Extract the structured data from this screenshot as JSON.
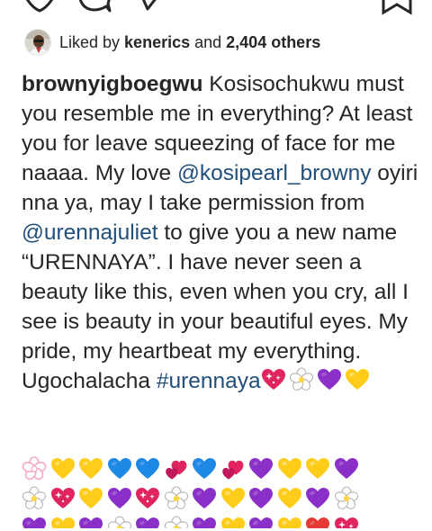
{
  "actions": {
    "like_icon": "heart-outline-icon",
    "comment_icon": "comment-bubble-icon",
    "share_icon": "paper-plane-icon",
    "save_icon": "bookmark-outline-icon"
  },
  "likes": {
    "prefix": "Liked by ",
    "user": "kenerics",
    "middle": " and ",
    "count": "2,404 others"
  },
  "caption": {
    "username": "brownyigboegwu",
    "text_1": " Kosisochukwu must you resemble me in everything? At least you for leave squeezing of face for me naaaa. My love ",
    "mention_1": "@kosipearl_browny",
    "text_2": " oyiri nna ya, may I take permission from ",
    "mention_2": "@urennajuliet",
    "text_3": " to give you a new name “URENNAYA”. I have never seen a beauty like this, even when you cry, all I see is beauty in your beautiful eyes. My pride, my heartbeat my everything. Ugochalacha ",
    "hashtag": "#urennaya"
  },
  "emoji_palette": {
    "purple_heart": "#8b2fc9",
    "yellow_heart": "#ffcc1a",
    "blue_heart": "#1e88e5",
    "sparkling_heart": "#e0245e",
    "growing_heart": "#e0245e",
    "blossom": "#ffffff",
    "pink_blossom": "#f7a8c4"
  },
  "emoji_rows": [
    [
      "blossom-outline",
      "yellow_heart",
      "yellow_heart",
      "blue_heart",
      "blue_heart",
      "two_hearts",
      "blue_heart",
      "two_hearts",
      "purple_heart",
      "yellow_heart",
      "yellow_heart",
      "purple_heart"
    ],
    [
      "blossom",
      "sparkling_heart",
      "yellow_heart",
      "purple_heart",
      "sparkling_heart",
      "blossom",
      "purple_heart",
      "yellow_heart",
      "purple_heart",
      "yellow_heart",
      "purple_heart",
      "blossom"
    ],
    [
      "purple_heart",
      "yellow_heart",
      "purple_heart",
      "blossom",
      "purple_heart",
      "blossom",
      "purple_heart",
      "yellow_heart",
      "purple_heart",
      "yellow_heart",
      "red_heart",
      "sparkling_heart"
    ]
  ],
  "inline_emojis": [
    "sparkling_heart",
    "blossom",
    "purple_heart",
    "yellow_heart"
  ]
}
